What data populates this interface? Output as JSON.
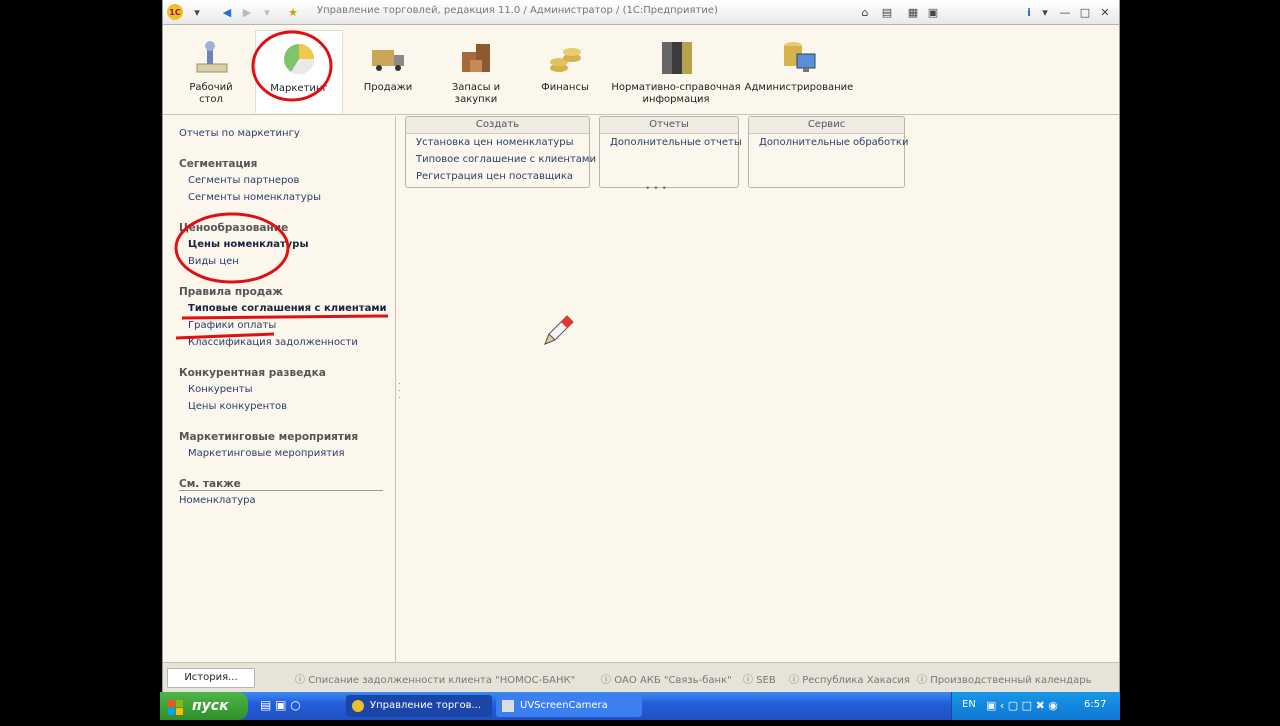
{
  "window": {
    "title": "Управление торговлей, редакция 11.0 / Администратор / (1С:Предприятие)"
  },
  "sections": [
    {
      "label": "Рабочий\nстол",
      "icon": "desk-icon"
    },
    {
      "label": "Маркетинг",
      "icon": "pie-chart-icon"
    },
    {
      "label": "Продажи",
      "icon": "truck-icon"
    },
    {
      "label": "Запасы и\nзакупки",
      "icon": "boxes-icon"
    },
    {
      "label": "Финансы",
      "icon": "coins-icon"
    },
    {
      "label": "Нормативно-справочная\nинформация",
      "icon": "binders-icon"
    },
    {
      "label": "Администрирование",
      "icon": "admin-icon"
    }
  ],
  "nav": {
    "top_link": "Отчеты по маркетингу",
    "groups": [
      {
        "title": "Сегментация",
        "items": [
          "Сегменты партнеров",
          "Сегменты номенклатуры"
        ]
      },
      {
        "title": "Ценообразование",
        "items": [
          "Цены номенклатуры",
          "Виды цен"
        ]
      },
      {
        "title": "Правила продаж",
        "items": [
          "Типовые соглашения с клиентами",
          "Графики оплаты",
          "Классификация задолженности"
        ]
      },
      {
        "title": "Конкурентная разведка",
        "items": [
          "Конкуренты",
          "Цены конкурентов"
        ]
      },
      {
        "title": "Маркетинговые мероприятия",
        "items": [
          "Маркетинговые мероприятия"
        ]
      },
      {
        "title": "См. также",
        "items": [
          "Номенклатура"
        ]
      }
    ]
  },
  "panels": [
    {
      "title": "Создать",
      "items": [
        "Установка цен номенклатуры",
        "Типовое соглашение с клиентами",
        "Регистрация цен поставщика"
      ]
    },
    {
      "title": "Отчеты",
      "items": [
        "Дополнительные отчеты"
      ]
    },
    {
      "title": "Сервис",
      "items": [
        "Дополнительные обработки"
      ]
    }
  ],
  "status": {
    "history_button": "История...",
    "items": [
      "Списание задолженности клиента \"НОМОС-БАНК\"",
      "ОАО АКБ \"Связь-банк\"",
      "SEB",
      "Республика Хакасия",
      "Производственный календарь"
    ]
  },
  "taskbar": {
    "start_label": "пуск",
    "tasks": [
      "Управление торгов...",
      "UVScreenCamera"
    ],
    "lang": "EN",
    "clock": "6:57"
  },
  "colors": {
    "background": "#fbf7ec",
    "annotation_red": "#e01010",
    "taskbar_blue": "#245edb",
    "start_green": "#3ea236"
  }
}
